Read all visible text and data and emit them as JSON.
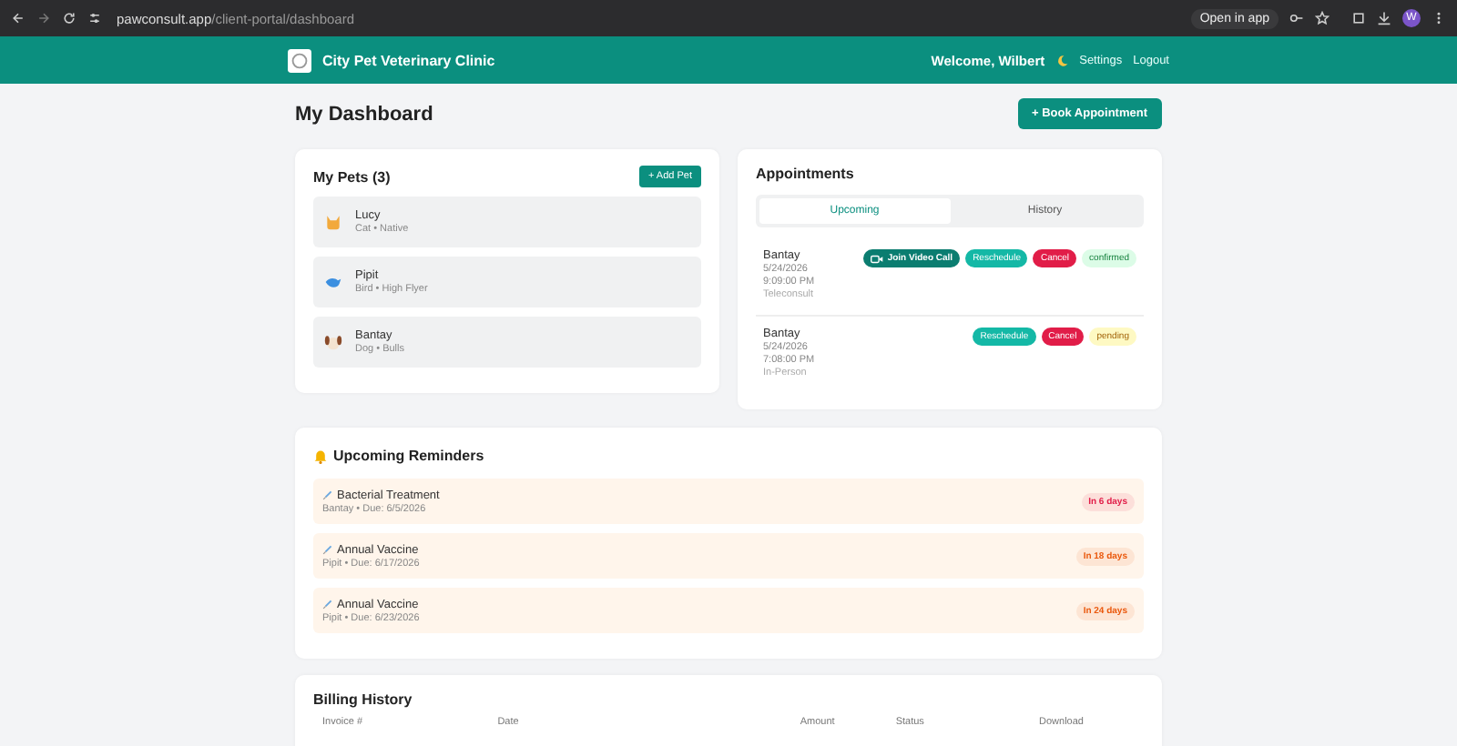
{
  "browser": {
    "url_host": "pawconsult.app",
    "url_path": "/client-portal/dashboard",
    "open_in_app": "Open in app",
    "profile_initial": "W"
  },
  "nav": {
    "brand": "City Pet Veterinary Clinic",
    "welcome": "Welcome, Wilbert",
    "links": [
      "Settings",
      "Logout"
    ]
  },
  "page_title": "My Dashboard",
  "book_button": "+ Book Appointment",
  "pets": {
    "title": "My Pets (3)",
    "add_button": "+ Add Pet",
    "items": [
      {
        "kind": "cat",
        "name": "Lucy",
        "details": "Cat • Native"
      },
      {
        "kind": "bird",
        "name": "Pipit",
        "details": "Bird • High Flyer"
      },
      {
        "kind": "dog",
        "name": "Bantay",
        "details": "Dog • Bulls"
      }
    ]
  },
  "appointments": {
    "title": "Appointments",
    "tabs": [
      {
        "label": "Upcoming",
        "selected": true
      },
      {
        "label": "History",
        "selected": false
      }
    ],
    "items": [
      {
        "pet": "Bantay",
        "date": "5/24/2026",
        "time": "9:09:00 PM",
        "type": "Teleconsult",
        "actions": [
          {
            "kind": "video",
            "label": "Join Video Call"
          },
          {
            "kind": "reschedule",
            "label": "Reschedule"
          },
          {
            "kind": "cancel",
            "label": "Cancel"
          }
        ],
        "status": {
          "kind": "confirmed",
          "label": "confirmed"
        }
      },
      {
        "pet": "Bantay",
        "date": "5/24/2026",
        "time": "7:08:00 PM",
        "type": "In-Person",
        "actions": [
          {
            "kind": "reschedule",
            "label": "Reschedule"
          },
          {
            "kind": "cancel",
            "label": "Cancel"
          }
        ],
        "status": {
          "kind": "pending",
          "label": "pending"
        }
      }
    ]
  },
  "reminders": {
    "title": "Upcoming Reminders",
    "items": [
      {
        "title": "Bacterial Treatment",
        "details": "Bantay • Due: 6/5/2026",
        "due_in": "In 6 days",
        "color": "#e11d48"
      },
      {
        "title": "Annual Vaccine",
        "details": "Pipit • Due: 6/17/2026",
        "due_in": "In 18 days",
        "color": "#ea580c"
      },
      {
        "title": "Annual Vaccine",
        "details": "Pipit • Due: 6/23/2026",
        "due_in": "In 24 days",
        "color": "#ea580c"
      }
    ]
  },
  "billing": {
    "title": "Billing History",
    "columns": [
      "Invoice #",
      "Date",
      "Amount",
      "Status",
      "Download"
    ]
  }
}
